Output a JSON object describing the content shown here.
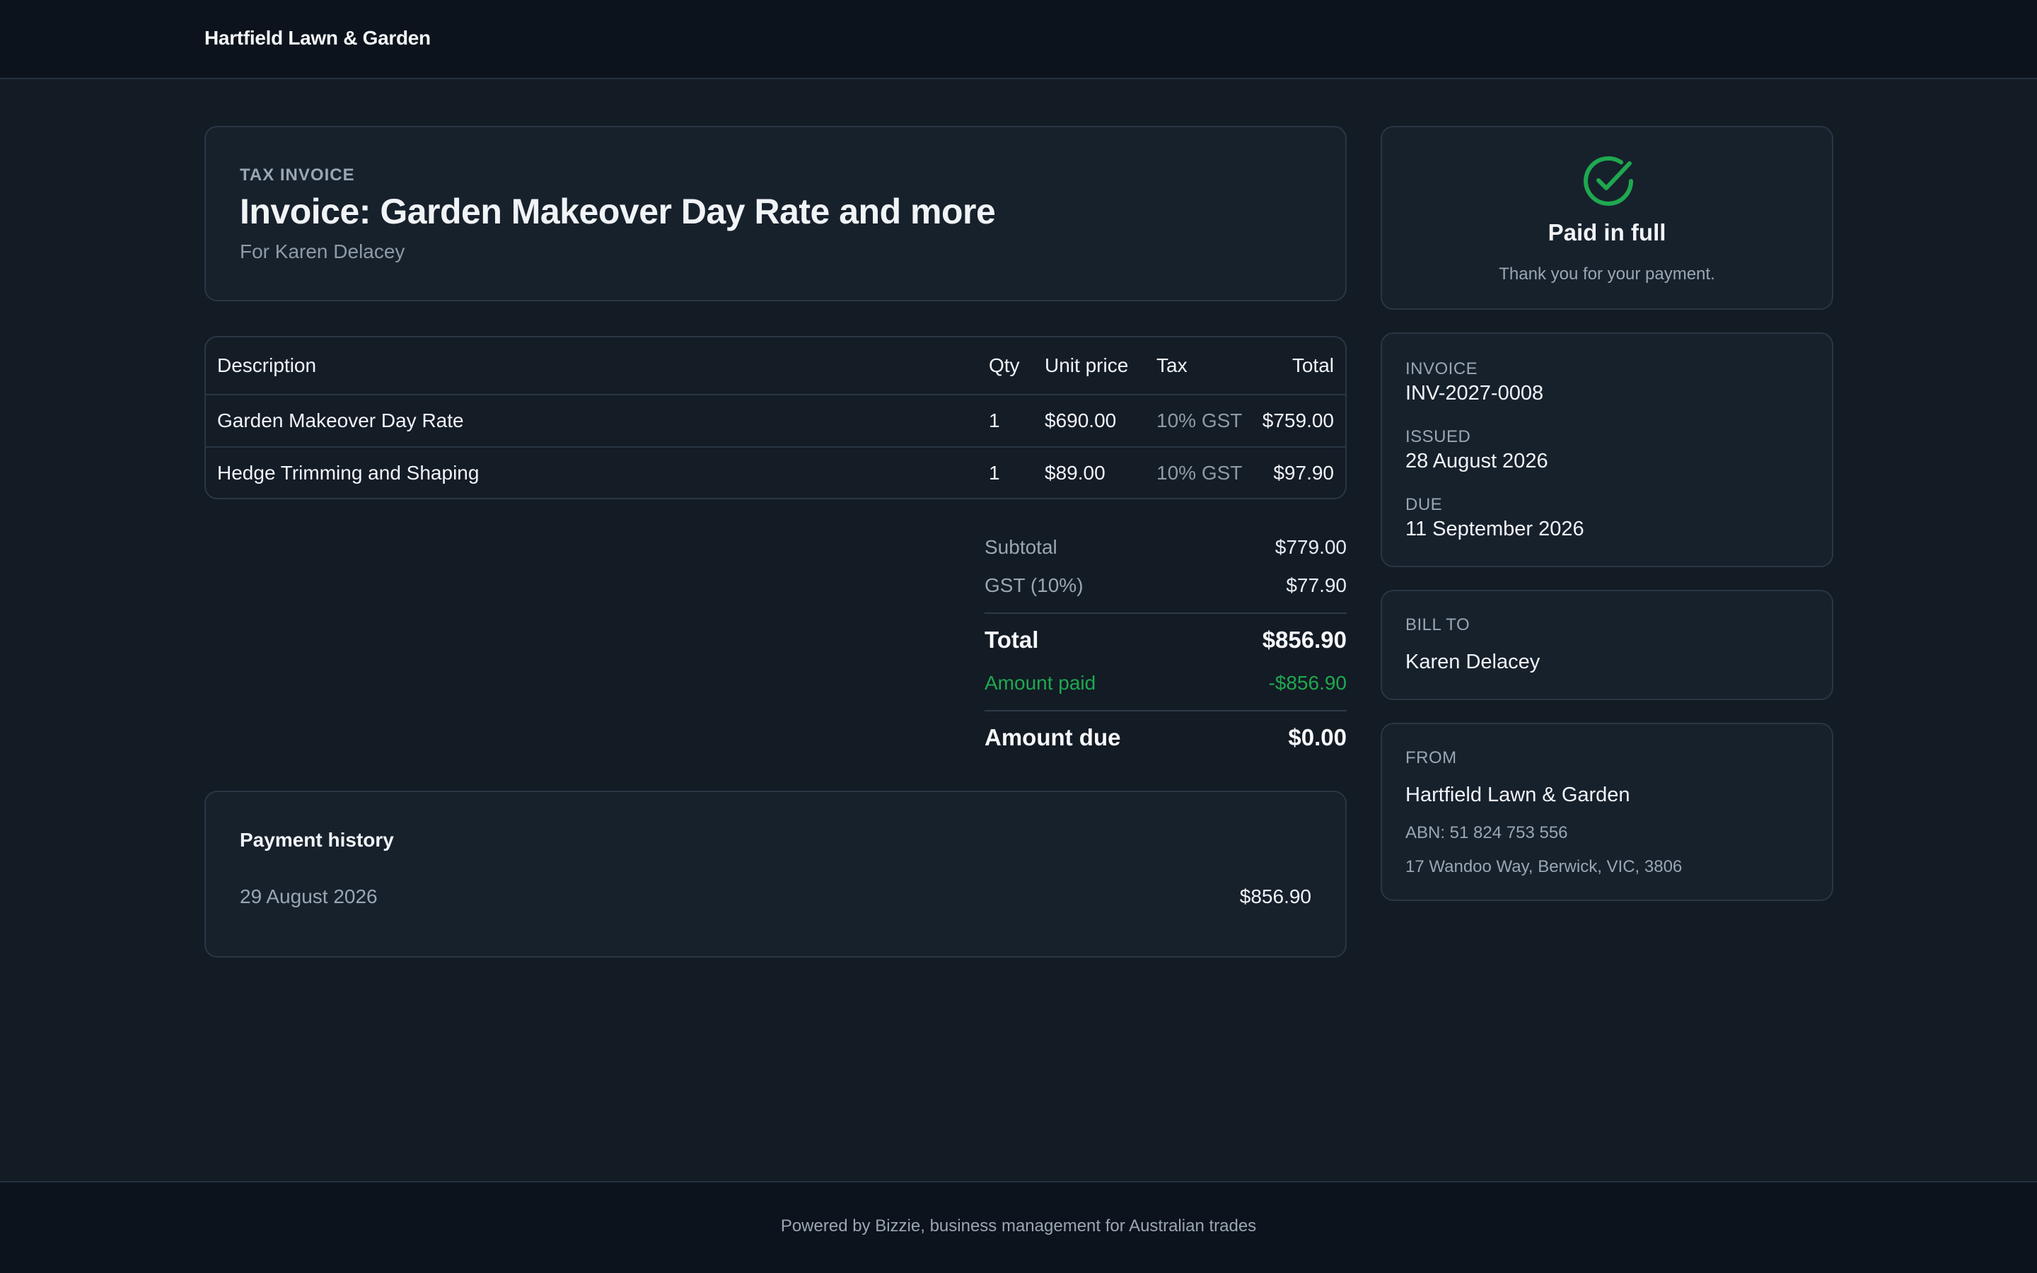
{
  "header": {
    "brand": "Hartfield Lawn & Garden"
  },
  "invoice_header": {
    "eyebrow": "TAX INVOICE",
    "title": "Invoice: Garden Makeover Day Rate and more",
    "subtitle": "For Karen Delacey"
  },
  "line_items": {
    "columns": [
      "Description",
      "Qty",
      "Unit price",
      "Tax",
      "Total"
    ],
    "rows": [
      [
        "Garden Makeover Day Rate",
        "1",
        "$690.00",
        "10% GST",
        "$759.00"
      ],
      [
        "Hedge Trimming and Shaping",
        "1",
        "$89.00",
        "10% GST",
        "$97.90"
      ]
    ]
  },
  "totals": {
    "subtotal_label": "Subtotal",
    "subtotal": "$779.00",
    "gst_label": "GST (10%)",
    "gst": "$77.90",
    "total_label": "Total",
    "total": "$856.90",
    "paid_label": "Amount paid",
    "paid": "-$856.90",
    "due_label": "Amount due",
    "due": "$0.00"
  },
  "payment_history": {
    "title": "Payment history",
    "entries": [
      {
        "date": "29 August 2026",
        "amount": "$856.90"
      }
    ]
  },
  "status": {
    "icon": "check-circle-icon",
    "title": "Paid in full",
    "subtitle": "Thank you for your payment.",
    "color": "#1fa84f"
  },
  "meta": {
    "invoice_label": "INVOICE",
    "invoice_number": "INV-2027-0008",
    "issued_label": "ISSUED",
    "issued": "28 August 2026",
    "due_label": "DUE",
    "due": "11 September 2026"
  },
  "bill_to": {
    "label": "BILL TO",
    "name": "Karen Delacey"
  },
  "from": {
    "label": "FROM",
    "name": "Hartfield Lawn & Garden",
    "abn": "ABN: 51 824 753 556",
    "address": "17 Wandoo Way, Berwick, VIC, 3806"
  },
  "footer": {
    "text": "Powered by Bizzie, business management for Australian trades"
  }
}
